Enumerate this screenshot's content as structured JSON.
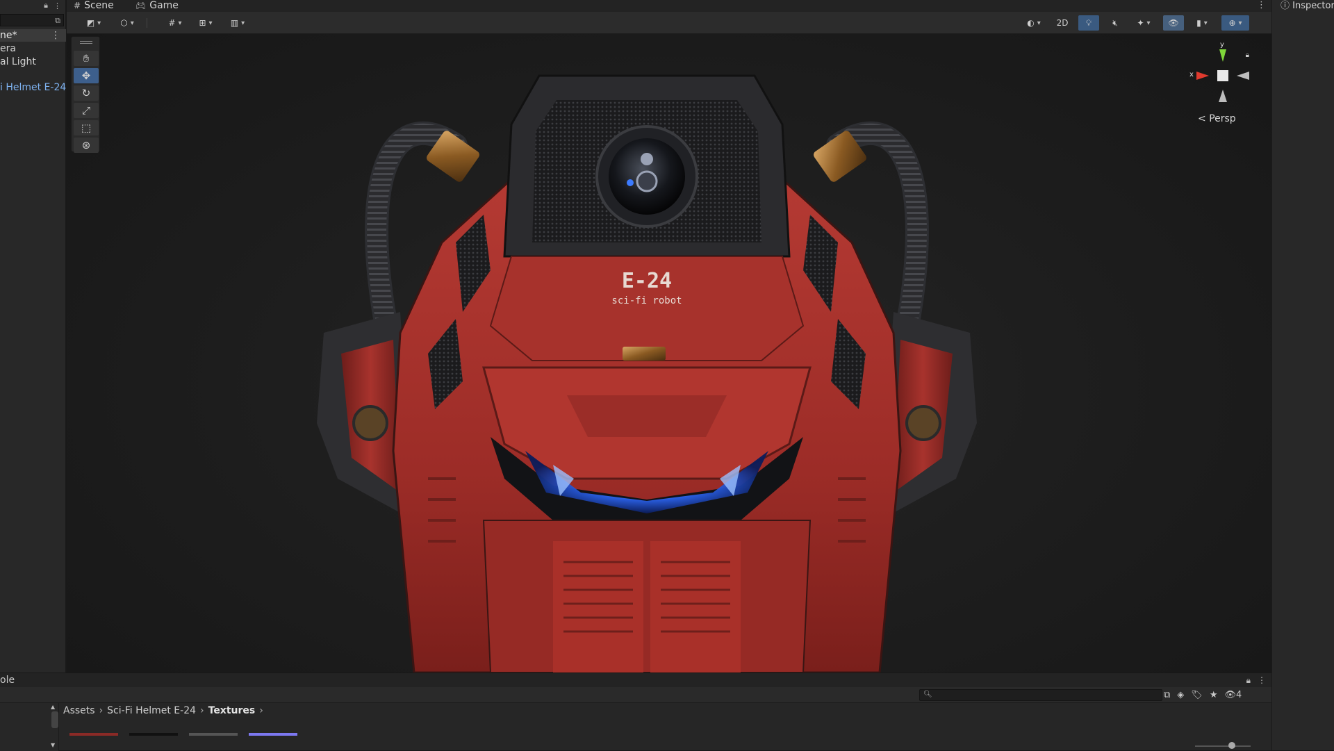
{
  "hierarchy": {
    "scene_label": "ne*",
    "items": [
      "era",
      "al Light",
      "i Helmet E-24"
    ]
  },
  "scene_tabs": [
    {
      "label": "Scene"
    },
    {
      "label": "Game"
    }
  ],
  "scene_toolbar": {
    "mode_2d": "2D",
    "projection_label": "Persp"
  },
  "helmet_decal": {
    "model": "E-24",
    "subtitle": "sci-fi robot"
  },
  "gizmo": {
    "x_label": "x",
    "y_label": "y"
  },
  "console": {
    "tab_label": "ole"
  },
  "project": {
    "breadcrumb": [
      "Assets",
      "Sci-Fi Helmet E-24",
      "Textures"
    ],
    "hidden_count": "4",
    "search_placeholder": ""
  },
  "inspector": {
    "tab_label": "Inspector"
  },
  "colors": {
    "selection_blue": "#7eb2f0",
    "helmet_red": "#a8322c",
    "visor_glow": "#2f6bff"
  }
}
